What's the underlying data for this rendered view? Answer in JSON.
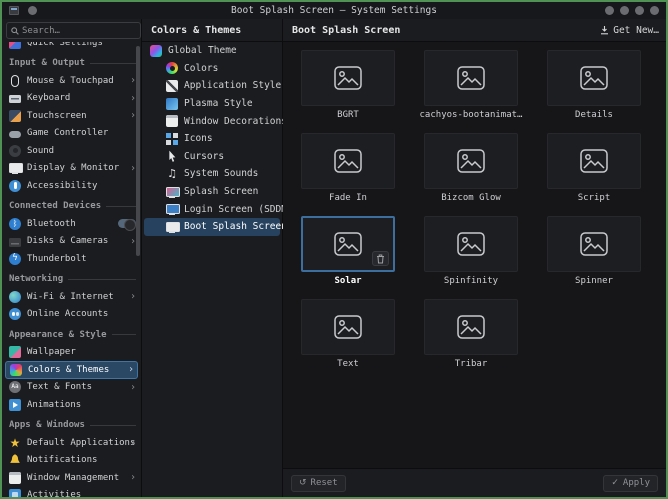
{
  "window": {
    "title": "Boot Splash Screen — System Settings"
  },
  "sidebar": {
    "search": {
      "placeholder": "Search…",
      "icon": "search-icon",
      "menu_icon": "hamburger-menu-icon"
    },
    "groups": [
      {
        "items": [
          {
            "label": "Quick Settings",
            "icon": "quick-settings-icon"
          }
        ]
      },
      {
        "header": "Input & Output",
        "items": [
          {
            "label": "Mouse & Touchpad",
            "icon": "mouse-icon",
            "chevron": true
          },
          {
            "label": "Keyboard",
            "icon": "keyboard-icon",
            "chevron": true
          },
          {
            "label": "Touchscreen",
            "icon": "touchscreen-icon",
            "chevron": true
          },
          {
            "label": "Game Controller",
            "icon": "game-controller-icon"
          },
          {
            "label": "Sound",
            "icon": "sound-icon"
          },
          {
            "label": "Display & Monitor",
            "icon": "display-monitor-icon",
            "chevron": true
          },
          {
            "label": "Accessibility",
            "icon": "accessibility-icon"
          }
        ]
      },
      {
        "header": "Connected Devices",
        "items": [
          {
            "label": "Bluetooth",
            "icon": "bluetooth-icon",
            "toggle": "on"
          },
          {
            "label": "Disks & Cameras",
            "icon": "disks-cameras-icon",
            "chevron": true
          },
          {
            "label": "Thunderbolt",
            "icon": "thunderbolt-icon"
          }
        ]
      },
      {
        "header": "Networking",
        "items": [
          {
            "label": "Wi-Fi & Internet",
            "icon": "wifi-icon",
            "chevron": true
          },
          {
            "label": "Online Accounts",
            "icon": "online-accounts-icon"
          }
        ]
      },
      {
        "header": "Appearance & Style",
        "items": [
          {
            "label": "Wallpaper",
            "icon": "wallpaper-icon"
          },
          {
            "label": "Colors & Themes",
            "icon": "colors-themes-icon",
            "chevron": true,
            "selected": true
          },
          {
            "label": "Text & Fonts",
            "icon": "text-fonts-icon",
            "chevron": true
          },
          {
            "label": "Animations",
            "icon": "animations-icon"
          }
        ]
      },
      {
        "header": "Apps & Windows",
        "items": [
          {
            "label": "Default Applications",
            "icon": "star-icon",
            "chevron": true
          },
          {
            "label": "Notifications",
            "icon": "bell-icon"
          },
          {
            "label": "Window Management",
            "icon": "window-management-icon",
            "chevron": true
          },
          {
            "label": "Activities",
            "icon": "activities-icon"
          }
        ]
      }
    ]
  },
  "subpanel": {
    "title": "Colors & Themes",
    "items": [
      {
        "label": "Global Theme",
        "icon": "global-theme-icon"
      },
      {
        "label": "Colors",
        "icon": "colors-icon"
      },
      {
        "label": "Application Style",
        "icon": "application-style-icon"
      },
      {
        "label": "Plasma Style",
        "icon": "plasma-style-icon"
      },
      {
        "label": "Window Decorations",
        "icon": "window-decorations-icon"
      },
      {
        "label": "Icons",
        "icon": "icons-icon"
      },
      {
        "label": "Cursors",
        "icon": "cursors-icon"
      },
      {
        "label": "System Sounds",
        "icon": "system-sounds-icon"
      },
      {
        "label": "Splash Screen",
        "icon": "splash-screen-icon"
      },
      {
        "label": "Login Screen (SDDM)",
        "icon": "login-screen-icon"
      },
      {
        "label": "Boot Splash Screen",
        "icon": "boot-splash-screen-icon",
        "selected": true
      }
    ]
  },
  "main": {
    "title": "Boot Splash Screen",
    "get_new": {
      "label": "Get New…",
      "icon": "download-icon"
    },
    "themes": [
      {
        "label": "BGRT"
      },
      {
        "label": "cachyos-bootanimat…"
      },
      {
        "label": "Details"
      },
      {
        "label": "Fade In"
      },
      {
        "label": "Bizcom Glow"
      },
      {
        "label": "Script"
      },
      {
        "label": "Solar",
        "selected": true,
        "deletable": true
      },
      {
        "label": "Spinfinity"
      },
      {
        "label": "Spinner"
      },
      {
        "label": "Text"
      },
      {
        "label": "Tribar"
      }
    ],
    "footer": {
      "reset": {
        "label": "Reset",
        "icon": "undo-icon"
      },
      "apply": {
        "label": "Apply",
        "icon": "apply-check-icon"
      }
    }
  },
  "colors": {
    "window_border": "#4f9254",
    "selection_bg": "#2a4764",
    "selection_border": "#3f74a6",
    "tile_selected_border": "#3c6e9f",
    "panel_bg": "#1b1c1f",
    "grid_bg": "#161619",
    "tile_bg": "#1d1e22",
    "text": "#d6d7d9"
  }
}
